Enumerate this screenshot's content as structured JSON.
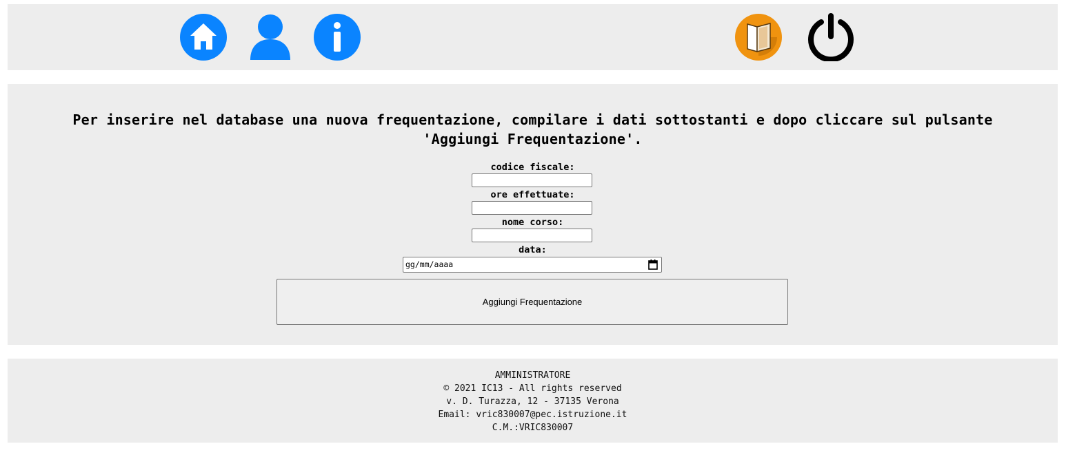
{
  "header": {
    "icons": {
      "home": "home-icon",
      "user": "user-icon",
      "info": "info-icon",
      "book": "book-icon",
      "power": "power-icon"
    },
    "colors": {
      "blue": "#0a84ff",
      "orange": "#f0930f",
      "black": "#000000"
    }
  },
  "main": {
    "instructions_line1": "Per inserire nel database una nuova frequentazione, compilare i dati sottostanti e dopo cliccare sul pulsante",
    "instructions_line2": "'Aggiungi Frequentazione'.",
    "form": {
      "codice_fiscale_label": "codice fiscale:",
      "codice_fiscale_value": "",
      "ore_effettuate_label": "ore effettuate:",
      "ore_effettuate_value": "",
      "nome_corso_label": "nome corso:",
      "nome_corso_value": "",
      "data_label": "data:",
      "data_placeholder": "gg/mm/aaaa",
      "submit_label": "Aggiungi Frequentazione"
    }
  },
  "footer": {
    "role": "AMMINISTRATORE",
    "copyright": "© 2021 IC13 - All rights reserved",
    "address": "v. D. Turazza, 12 - 37135 Verona",
    "email": "Email: vric830007@pec.istruzione.it",
    "cm": "C.M.:VRIC830007"
  }
}
